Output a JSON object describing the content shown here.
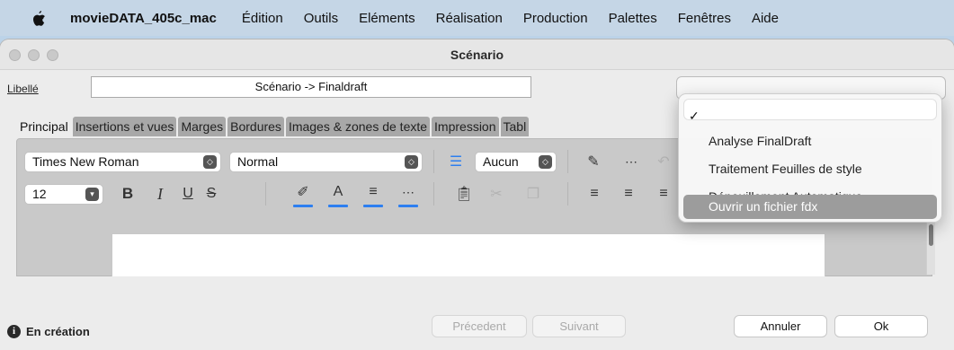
{
  "menubar": {
    "app_name": "movieDATA_405c_mac",
    "items": [
      "Édition",
      "Outils",
      "Eléments",
      "Réalisation",
      "Production",
      "Palettes",
      "Fenêtres",
      "Aide"
    ]
  },
  "window": {
    "title": "Scénario",
    "libelle_label": "Libellé",
    "title_value": "Scénario -> Finaldraft"
  },
  "tabs": [
    "Principal",
    "Insertions et vues",
    "Marges",
    "Bordures",
    "Images & zones de texte",
    "Impression",
    "Tabl"
  ],
  "toolbar": {
    "font_family": "Times New Roman",
    "style": "Normal",
    "list_style": "Aucun",
    "font_size": "12",
    "bold": "B",
    "italic": "I",
    "underline": "U",
    "strike": "S",
    "text_color": "A",
    "highlight_color": "#2d7ff0"
  },
  "popup_menu": {
    "checked_mark": "✓",
    "items": [
      "Analyse FinalDraft",
      "Traitement Feuilles de style",
      "Dépouillement Automatique",
      "Ouvrir un fichier fdx"
    ],
    "highlighted_index": 3
  },
  "footer": {
    "status": "En création",
    "prev_label": "Précedent",
    "next_label": "Suivant",
    "cancel_label": "Annuler",
    "ok_label": "Ok"
  }
}
